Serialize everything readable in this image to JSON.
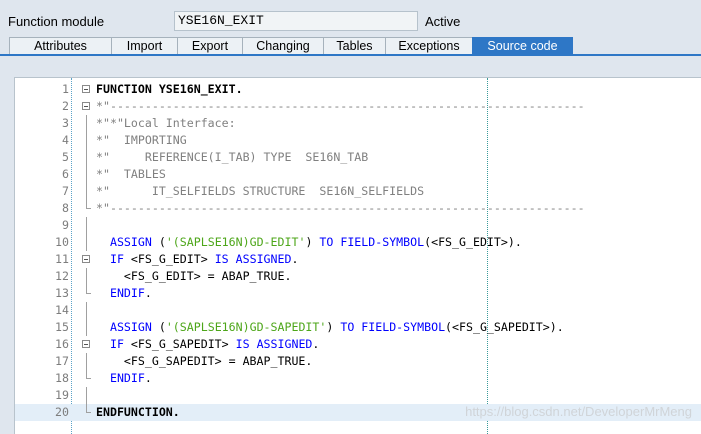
{
  "header": {
    "function_module_label": "Function module",
    "function_module_value": "YSE16N_EXIT",
    "status": "Active"
  },
  "tabs": [
    {
      "label": "Attributes",
      "active": false
    },
    {
      "label": "Import",
      "active": false
    },
    {
      "label": "Export",
      "active": false
    },
    {
      "label": "Changing",
      "active": false
    },
    {
      "label": "Tables",
      "active": false
    },
    {
      "label": "Exceptions",
      "active": false
    },
    {
      "label": "Source code",
      "active": true
    }
  ],
  "editor": {
    "lines": [
      {
        "n": "1",
        "tokens": [
          [
            "kwb",
            "FUNCTION YSE16N_EXIT."
          ]
        ]
      },
      {
        "n": "2",
        "tokens": [
          [
            "cm",
            "*\"--------------------------------------------------------------------"
          ]
        ]
      },
      {
        "n": "3",
        "tokens": [
          [
            "cm",
            "*\"*\"Local Interface:"
          ]
        ]
      },
      {
        "n": "4",
        "tokens": [
          [
            "cm",
            "*\"  IMPORTING"
          ]
        ]
      },
      {
        "n": "5",
        "tokens": [
          [
            "cm",
            "*\"     REFERENCE(I_TAB) TYPE  SE16N_TAB"
          ]
        ]
      },
      {
        "n": "6",
        "tokens": [
          [
            "cm",
            "*\"  TABLES"
          ]
        ]
      },
      {
        "n": "7",
        "tokens": [
          [
            "cm",
            "*\"      IT_SELFIELDS STRUCTURE  SE16N_SELFIELDS"
          ]
        ]
      },
      {
        "n": "8",
        "tokens": [
          [
            "cm",
            "*\"--------------------------------------------------------------------"
          ]
        ]
      },
      {
        "n": "9",
        "tokens": []
      },
      {
        "n": "10",
        "tokens": [
          [
            "id",
            "  "
          ],
          [
            "kw",
            "ASSIGN"
          ],
          [
            "id",
            " ("
          ],
          [
            "str",
            "'(SAPLSE16N)GD-EDIT'"
          ],
          [
            "id",
            ") "
          ],
          [
            "kw",
            "TO FIELD-SYMBOL"
          ],
          [
            "id",
            "(<FS_G_EDIT>)."
          ]
        ]
      },
      {
        "n": "11",
        "tokens": [
          [
            "id",
            "  "
          ],
          [
            "kw",
            "IF"
          ],
          [
            "id",
            " <FS_G_EDIT> "
          ],
          [
            "kw",
            "IS ASSIGNED"
          ],
          [
            "id",
            "."
          ]
        ]
      },
      {
        "n": "12",
        "tokens": [
          [
            "id",
            "    <FS_G_EDIT> = ABAP_TRUE."
          ]
        ]
      },
      {
        "n": "13",
        "tokens": [
          [
            "id",
            "  "
          ],
          [
            "kw",
            "ENDIF"
          ],
          [
            "id",
            "."
          ]
        ]
      },
      {
        "n": "14",
        "tokens": []
      },
      {
        "n": "15",
        "tokens": [
          [
            "id",
            "  "
          ],
          [
            "kw",
            "ASSIGN"
          ],
          [
            "id",
            " ("
          ],
          [
            "str",
            "'(SAPLSE16N)GD-SAPEDIT'"
          ],
          [
            "id",
            ") "
          ],
          [
            "kw",
            "TO FIELD-SYMBOL"
          ],
          [
            "id",
            "(<FS_G_SAPEDIT>)."
          ]
        ]
      },
      {
        "n": "16",
        "tokens": [
          [
            "id",
            "  "
          ],
          [
            "kw",
            "IF"
          ],
          [
            "id",
            " <FS_G_SAPEDIT> "
          ],
          [
            "kw",
            "IS ASSIGNED"
          ],
          [
            "id",
            "."
          ]
        ]
      },
      {
        "n": "17",
        "tokens": [
          [
            "id",
            "    <FS_G_SAPEDIT> = ABAP_TRUE."
          ]
        ]
      },
      {
        "n": "18",
        "tokens": [
          [
            "id",
            "  "
          ],
          [
            "kw",
            "ENDIF"
          ],
          [
            "id",
            "."
          ]
        ]
      },
      {
        "n": "19",
        "tokens": []
      },
      {
        "n": "20",
        "tokens": [
          [
            "kwb",
            "ENDFUNCTION."
          ]
        ]
      }
    ]
  },
  "watermark": "https://blog.csdn.net/DeveloperMrMeng"
}
